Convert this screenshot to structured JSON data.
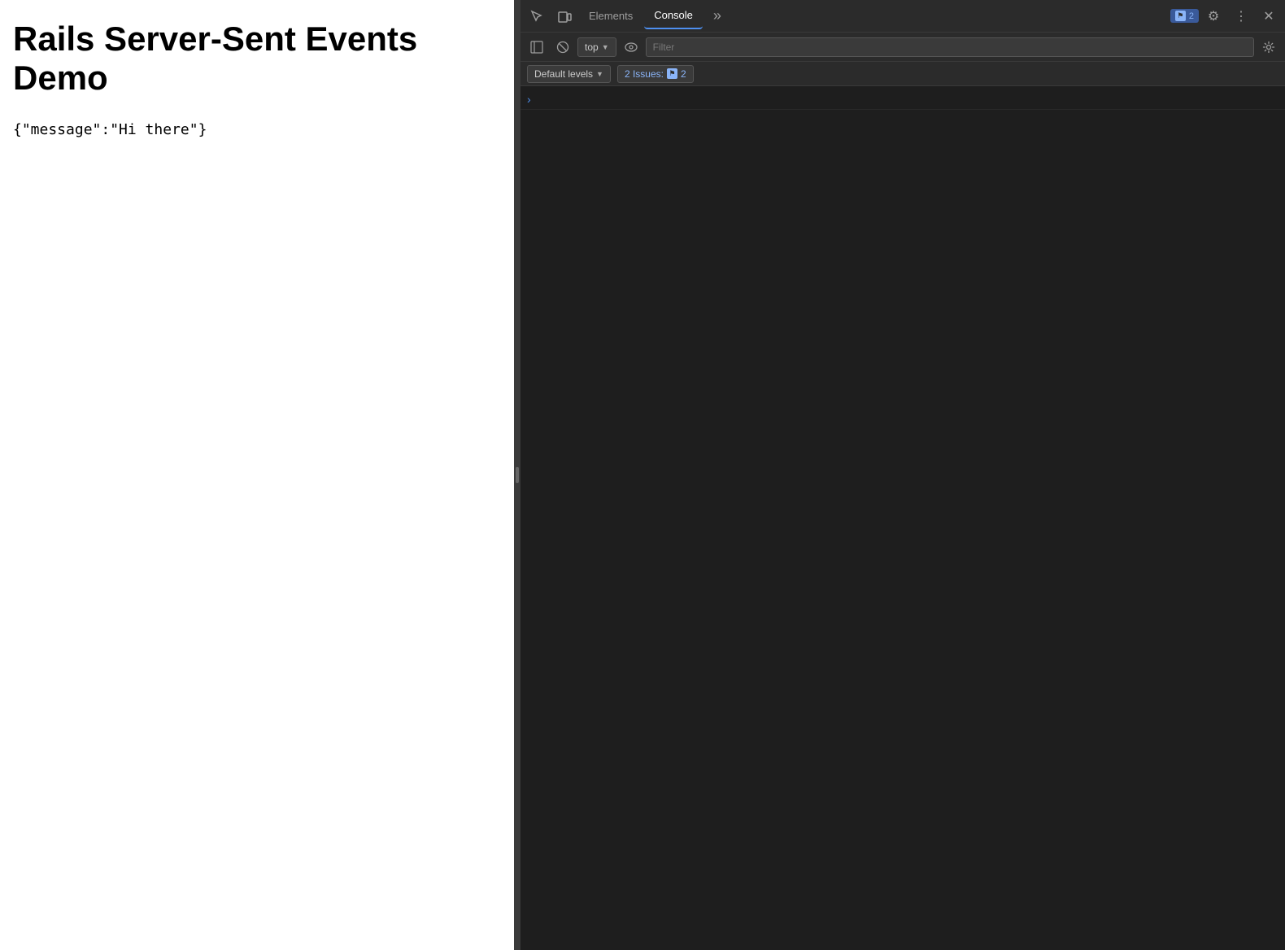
{
  "webpage": {
    "title_line1": "Rails Server-Sent Events",
    "title_line2": "Demo",
    "message": "{\"message\":\"Hi there\"}"
  },
  "devtools": {
    "tabs": [
      {
        "label": "Elements",
        "active": false
      },
      {
        "label": "Console",
        "active": true
      }
    ],
    "more_tabs_label": "»",
    "badge": {
      "count": "2",
      "text": "2"
    },
    "settings_icon": "⚙",
    "more_icon": "⋮",
    "close_icon": "✕"
  },
  "console_toolbar": {
    "sidebar_icon": "▤",
    "block_icon": "⊘",
    "top_selector": "top",
    "eye_icon": "👁",
    "filter_placeholder": "Filter",
    "settings_icon": "⚙"
  },
  "levels_toolbar": {
    "default_levels_label": "Default levels",
    "issues_label": "2 Issues:",
    "issues_count": "2"
  },
  "console_output": {
    "rows": [
      {
        "content": ""
      }
    ]
  }
}
